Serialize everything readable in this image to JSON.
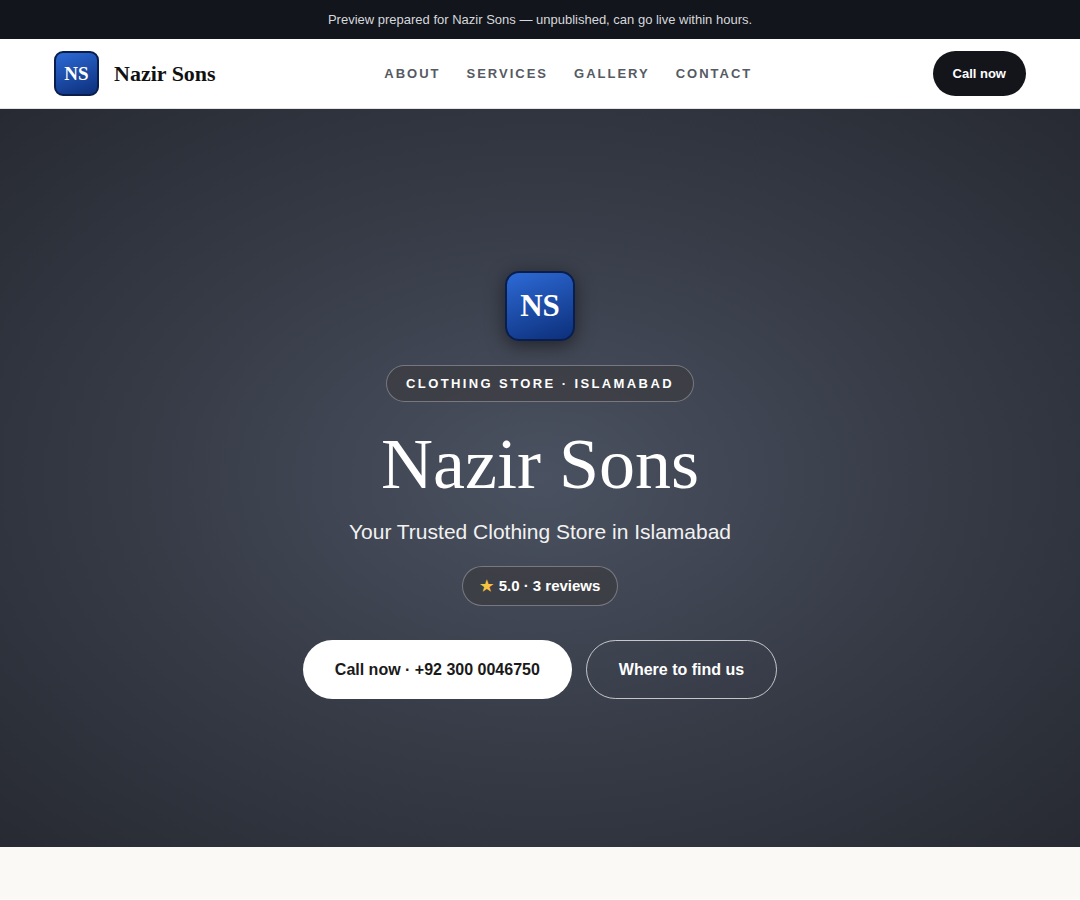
{
  "banner": {
    "text": "Preview prepared for Nazir Sons — unpublished, can go live within hours."
  },
  "header": {
    "logo": "NS",
    "brand": "Nazir Sons",
    "nav": [
      {
        "label": "ABOUT"
      },
      {
        "label": "SERVICES"
      },
      {
        "label": "GALLERY"
      },
      {
        "label": "CONTACT"
      }
    ],
    "cta": "Call now"
  },
  "hero": {
    "logo": "NS",
    "category": "CLOTHING STORE · ISLAMABAD",
    "title": "Nazir Sons",
    "subtitle": "Your Trusted Clothing Store in Islamabad",
    "rating": {
      "star": "★",
      "text": "5.0 · 3 reviews"
    },
    "buttons": [
      {
        "label": "Call now · +92 300 0046750",
        "kind": "primary"
      },
      {
        "label": "Where to find us",
        "kind": "outline"
      }
    ]
  }
}
